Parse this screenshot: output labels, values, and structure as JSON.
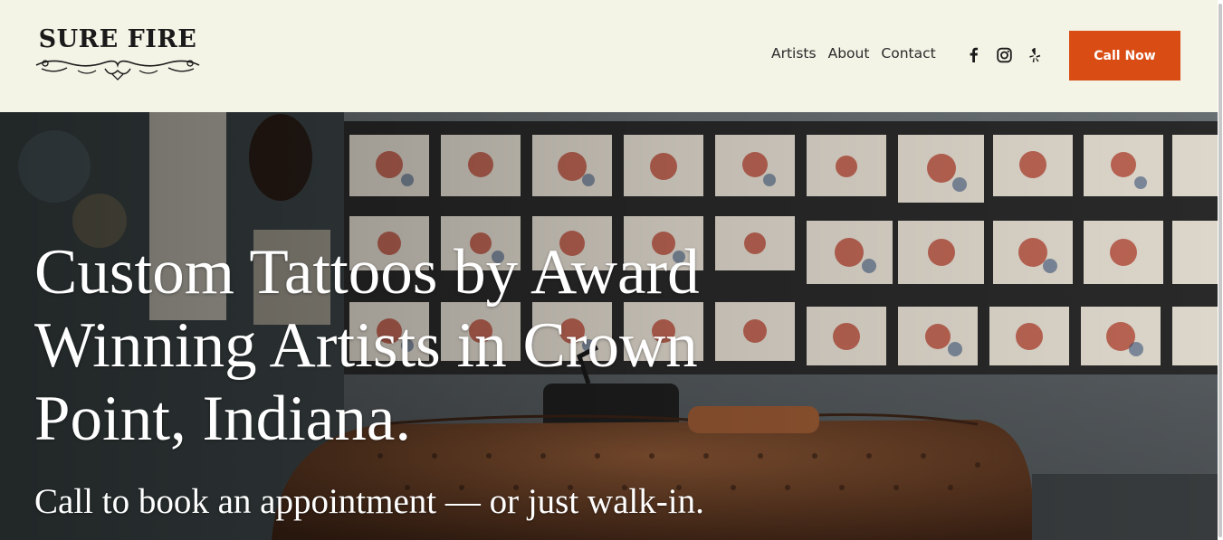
{
  "header": {
    "logo_text": "SURE FIRE",
    "nav": [
      {
        "label": "Artists"
      },
      {
        "label": "About"
      },
      {
        "label": "Contact"
      }
    ],
    "social": [
      {
        "icon": "facebook-icon"
      },
      {
        "icon": "instagram-icon"
      },
      {
        "icon": "yelp-icon"
      }
    ],
    "cta_label": "Call Now"
  },
  "hero": {
    "headline": "Custom Tattoos by Award Winning Artists in Crown Point, Indiana.",
    "subheadline": "Call to book an appointment — or just walk-in."
  },
  "colors": {
    "header_bg": "#f3f3e6",
    "accent": "#d94c13",
    "text_dark": "#2a2a2a",
    "hero_text": "#ffffff"
  }
}
